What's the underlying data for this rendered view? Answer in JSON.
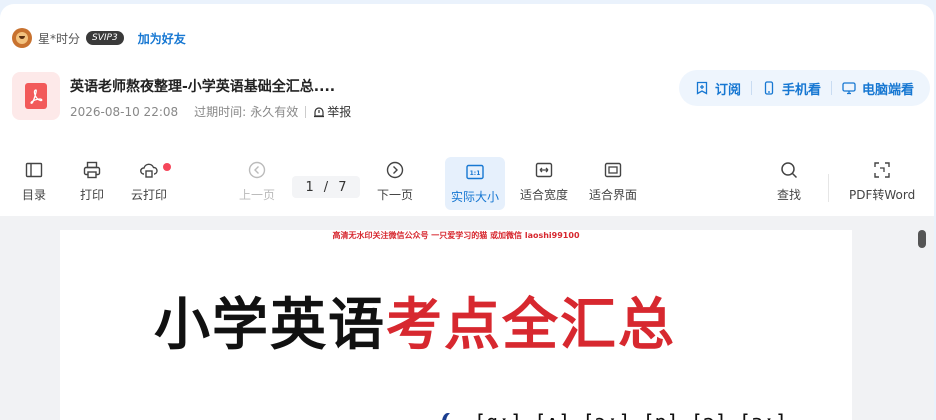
{
  "user": {
    "name": "星*时分",
    "badge": "SVIP3",
    "add_friend": "加为好友"
  },
  "document": {
    "title": "英语老师熬夜整理-小学英语基础全汇总....",
    "date": "2026-08-10 22:08",
    "expiry_label": "过期时间:",
    "expiry_value": "永久有效",
    "report": "举报"
  },
  "actions": {
    "subscribe": "订阅",
    "mobile": "手机看",
    "desktop": "电脑端看"
  },
  "toolbar": {
    "toc": "目录",
    "print": "打印",
    "cloud_print": "云打印",
    "prev": "上一页",
    "page_current": "1",
    "page_sep": "/",
    "page_total": "7",
    "next": "下一页",
    "actual_size_icon": "1:1",
    "actual_size": "实际大小",
    "fit_width": "适合宽度",
    "fit_page": "适合界面",
    "find": "查找",
    "pdf_to_word": "PDF转Word"
  },
  "content": {
    "watermark": "高清无水印关注微信公众号 一只爱学习的猫 或加微信 laoshi99100",
    "title_black": "小学英语",
    "title_red": "考点全汇总",
    "phonetics": "[ɑː] [ʌ] [ɔː] [p] [ə] [ɜː]"
  },
  "colors": {
    "accent": "#1677d2",
    "title_red": "#d7282f",
    "pdf_red": "#f25a5a",
    "dot_red": "#f5465a"
  },
  "icons": {
    "avatar": "user-avatar",
    "file": "pdf-file-icon",
    "report": "alert-icon",
    "subscribe": "bookmark-plus-icon",
    "mobile": "phone-icon",
    "desktop": "monitor-icon",
    "toc": "sidebar-icon",
    "print": "printer-icon",
    "cloud_print": "cloud-print-icon",
    "prev": "chevron-left-circle-icon",
    "next": "chevron-right-circle-icon",
    "fit_width": "fit-width-icon",
    "fit_page": "fit-page-icon",
    "find": "search-icon",
    "pdf_to_word": "convert-icon"
  }
}
